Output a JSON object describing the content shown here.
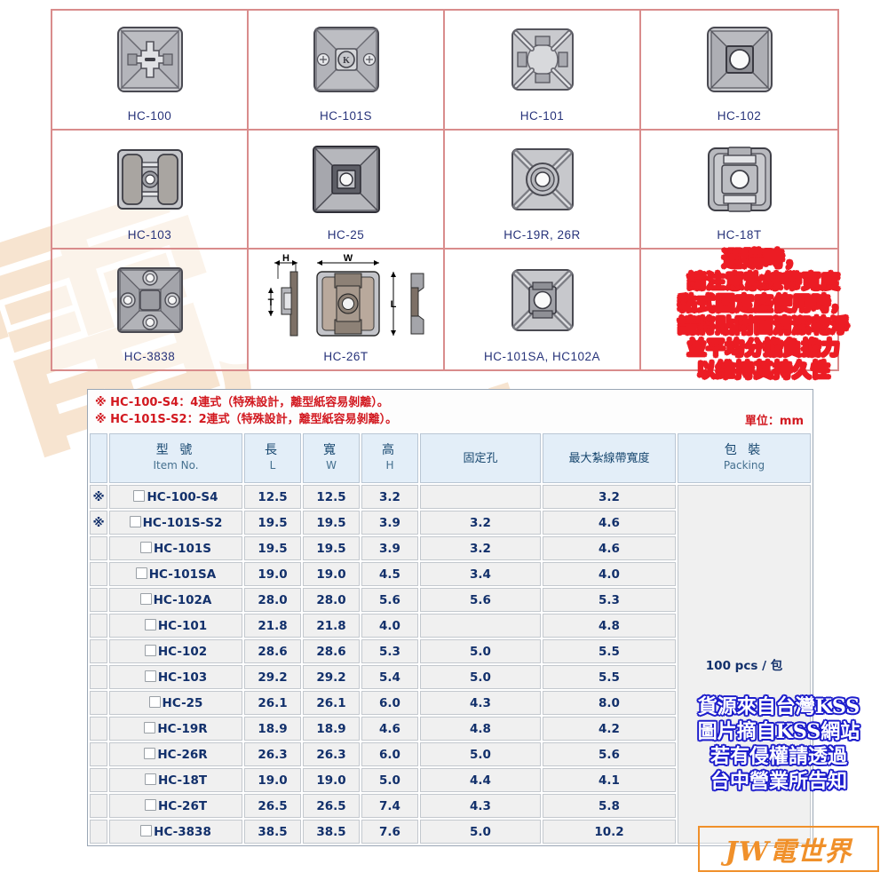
{
  "products": [
    {
      "code": "HC-100",
      "art": "base-slot"
    },
    {
      "code": "HC-101S",
      "art": "base-k-screw"
    },
    {
      "code": "HC-101",
      "art": "base-open"
    },
    {
      "code": "HC-102",
      "art": "base-hole"
    },
    {
      "code": "HC-103",
      "art": "base-bar"
    },
    {
      "code": "HC-25",
      "art": "base-square-hole"
    },
    {
      "code": "HC-19R, 26R",
      "art": "base-round-hole"
    },
    {
      "code": "HC-18T",
      "art": "base-tall"
    },
    {
      "code": "HC-3838",
      "art": "base-4hole"
    },
    {
      "code": "HC-26T",
      "art": "dimension-drawing"
    },
    {
      "code": "HC-101SA, HC102A",
      "art": "base-hole2"
    },
    {
      "code": "",
      "art": "empty"
    }
  ],
  "dimension_labels": {
    "h": "H",
    "w": "W",
    "t": "T",
    "l": "L"
  },
  "red_note": {
    "lines": [
      "選購時，",
      "請注意紮線帶寬度",
      "黏式固定座使用時，",
      "請將貼附面清潔乾淨",
      "並平均分擔負擔力",
      "以維持其持久性"
    ],
    "color": "#ec1c24"
  },
  "notes": {
    "line1": "※ HC-100-S4：4連式（特殊設計，離型紙容易剝離）。",
    "line2": "※ HC-101S-S2：2連式（特殊設計，離型紙容易剝離）。",
    "unit": "單位：mm",
    "color": "#d2181f"
  },
  "table": {
    "headers": [
      {
        "cn": "",
        "en": ""
      },
      {
        "cn": "型  號",
        "en": "Item No."
      },
      {
        "cn": "長",
        "en": "L"
      },
      {
        "cn": "寬",
        "en": "W"
      },
      {
        "cn": "高",
        "en": "H"
      },
      {
        "cn": "固定孔",
        "en": ""
      },
      {
        "cn": "最大紮線帶寬度",
        "en": ""
      },
      {
        "cn": "包  裝",
        "en": "Packing"
      }
    ],
    "packing_value": "100 pcs / 包",
    "rows": [
      {
        "mark": "※",
        "item": "HC-100-S4",
        "l": "12.5",
        "w": "12.5",
        "h": "3.2",
        "hole": "",
        "strap": "3.2"
      },
      {
        "mark": "※",
        "item": "HC-101S-S2",
        "l": "19.5",
        "w": "19.5",
        "h": "3.9",
        "hole": "3.2",
        "strap": "4.6"
      },
      {
        "mark": "",
        "item": "HC-101S",
        "l": "19.5",
        "w": "19.5",
        "h": "3.9",
        "hole": "3.2",
        "strap": "4.6"
      },
      {
        "mark": "",
        "item": "HC-101SA",
        "l": "19.0",
        "w": "19.0",
        "h": "4.5",
        "hole": "3.4",
        "strap": "4.0"
      },
      {
        "mark": "",
        "item": "HC-102A",
        "l": "28.0",
        "w": "28.0",
        "h": "5.6",
        "hole": "5.6",
        "strap": "5.3"
      },
      {
        "mark": "",
        "item": "HC-101",
        "l": "21.8",
        "w": "21.8",
        "h": "4.0",
        "hole": "",
        "strap": "4.8"
      },
      {
        "mark": "",
        "item": "HC-102",
        "l": "28.6",
        "w": "28.6",
        "h": "5.3",
        "hole": "5.0",
        "strap": "5.5"
      },
      {
        "mark": "",
        "item": "HC-103",
        "l": "29.2",
        "w": "29.2",
        "h": "5.4",
        "hole": "5.0",
        "strap": "5.5"
      },
      {
        "mark": "",
        "item": "HC-25",
        "l": "26.1",
        "w": "26.1",
        "h": "6.0",
        "hole": "4.3",
        "strap": "8.0"
      },
      {
        "mark": "",
        "item": "HC-19R",
        "l": "18.9",
        "w": "18.9",
        "h": "4.6",
        "hole": "4.8",
        "strap": "4.2"
      },
      {
        "mark": "",
        "item": "HC-26R",
        "l": "26.3",
        "w": "26.3",
        "h": "6.0",
        "hole": "5.0",
        "strap": "5.6"
      },
      {
        "mark": "",
        "item": "HC-18T",
        "l": "19.0",
        "w": "19.0",
        "h": "5.0",
        "hole": "4.4",
        "strap": "4.1"
      },
      {
        "mark": "",
        "item": "HC-26T",
        "l": "26.5",
        "w": "26.5",
        "h": "7.4",
        "hole": "4.3",
        "strap": "5.8"
      },
      {
        "mark": "",
        "item": "HC-3838",
        "l": "38.5",
        "w": "38.5",
        "h": "7.6",
        "hole": "5.0",
        "strap": "10.2"
      }
    ]
  },
  "blue_note": {
    "lines": [
      "貨源來自台灣KSS",
      "圖片摘自KSS網站",
      "若有侵權請透過",
      "台中營業所告知"
    ],
    "color": "#1c1ccc"
  },
  "logo": {
    "text": "JW電世界",
    "color": "#f0902a"
  },
  "background_watermark": {
    "glyph1": "電",
    "glyph2": "世",
    "glyph3": "界",
    "color": "#f6e0c8"
  }
}
